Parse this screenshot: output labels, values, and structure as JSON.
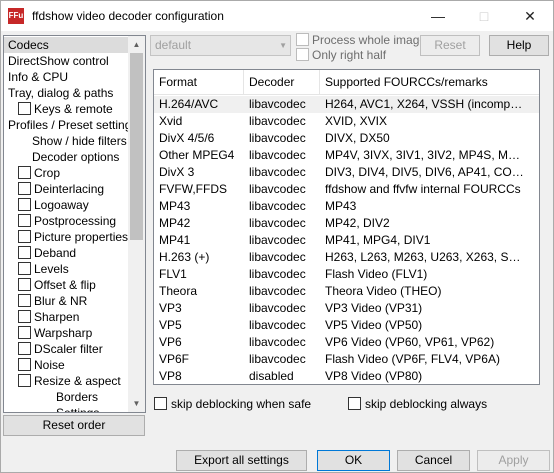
{
  "window": {
    "title": "ffdshow video decoder configuration",
    "icon_text": "FFu"
  },
  "sidebar": {
    "items": [
      {
        "label": "Codecs",
        "indent": 0,
        "check": false,
        "selected": true
      },
      {
        "label": "DirectShow control",
        "indent": 0,
        "check": false
      },
      {
        "label": "Info & CPU",
        "indent": 0,
        "check": false
      },
      {
        "label": "Tray, dialog & paths",
        "indent": 0,
        "check": false
      },
      {
        "label": "Keys & remote",
        "indent": 1,
        "check": true
      },
      {
        "label": "Profiles / Preset settings",
        "indent": 0,
        "check": false
      },
      {
        "label": "Show / hide filters",
        "indent": 2,
        "check": false
      },
      {
        "label": "Decoder options",
        "indent": 2,
        "check": false
      },
      {
        "label": "Crop",
        "indent": 1,
        "check": true
      },
      {
        "label": "Deinterlacing",
        "indent": 1,
        "check": true
      },
      {
        "label": "Logoaway",
        "indent": 1,
        "check": true
      },
      {
        "label": "Postprocessing",
        "indent": 1,
        "check": true
      },
      {
        "label": "Picture properties",
        "indent": 1,
        "check": true
      },
      {
        "label": "Deband",
        "indent": 1,
        "check": true
      },
      {
        "label": "Levels",
        "indent": 1,
        "check": true
      },
      {
        "label": "Offset & flip",
        "indent": 1,
        "check": true
      },
      {
        "label": "Blur & NR",
        "indent": 1,
        "check": true
      },
      {
        "label": "Sharpen",
        "indent": 1,
        "check": true
      },
      {
        "label": "Warpsharp",
        "indent": 1,
        "check": true
      },
      {
        "label": "DScaler filter",
        "indent": 1,
        "check": true
      },
      {
        "label": "Noise",
        "indent": 1,
        "check": true
      },
      {
        "label": "Resize & aspect",
        "indent": 1,
        "check": true
      },
      {
        "label": "Borders",
        "indent": 3,
        "check": false
      },
      {
        "label": "Settings",
        "indent": 3,
        "check": false
      }
    ],
    "reset_order_label": "Reset order"
  },
  "top": {
    "preset_value": "default",
    "process_whole_image": "Process whole image",
    "only_right_half": "Only right half",
    "reset_label": "Reset",
    "help_label": "Help"
  },
  "codecs": {
    "headers": [
      "Format",
      "Decoder",
      "Supported FOURCCs/remarks"
    ],
    "rows": [
      [
        "H.264/AVC",
        "libavcodec",
        "H264, AVC1, X264, VSSH (incomplete support)"
      ],
      [
        "Xvid",
        "libavcodec",
        "XVID, XVIX"
      ],
      [
        "DivX 4/5/6",
        "libavcodec",
        "DIVX, DX50"
      ],
      [
        "Other MPEG4",
        "libavcodec",
        "MP4V, 3IVX, 3IV1, 3IV2, MP4S, M4S2"
      ],
      [
        "DivX 3",
        "libavcodec",
        "DIV3, DIV4, DIV5, DIV6, AP41, COL1"
      ],
      [
        "FVFW,FFDS",
        "libavcodec",
        "ffdshow and ffvfw internal FOURCCs"
      ],
      [
        "MP43",
        "libavcodec",
        "MP43"
      ],
      [
        "MP42",
        "libavcodec",
        "MP42, DIV2"
      ],
      [
        "MP41",
        "libavcodec",
        "MP41, MPG4, DIV1"
      ],
      [
        "H.263 (+)",
        "libavcodec",
        "H263, L263, M263, U263, X263, S263"
      ],
      [
        "FLV1",
        "libavcodec",
        "Flash Video (FLV1)"
      ],
      [
        "Theora",
        "libavcodec",
        "Theora Video (THEO)"
      ],
      [
        "VP3",
        "libavcodec",
        "VP3 Video (VP31)"
      ],
      [
        "VP5",
        "libavcodec",
        "VP5 Video (VP50)"
      ],
      [
        "VP6",
        "libavcodec",
        "VP6 Video (VP60, VP61, VP62)"
      ],
      [
        "VP6F",
        "libavcodec",
        "Flash Video (VP6F, FLV4, VP6A)"
      ],
      [
        "VP8",
        "disabled",
        "VP8 Video (VP80)"
      ]
    ],
    "skip_deblocking_safe": "skip deblocking when safe",
    "skip_deblocking_always": "skip deblocking always"
  },
  "footer": {
    "export_label": "Export all settings",
    "ok_label": "OK",
    "cancel_label": "Cancel",
    "apply_label": "Apply"
  }
}
